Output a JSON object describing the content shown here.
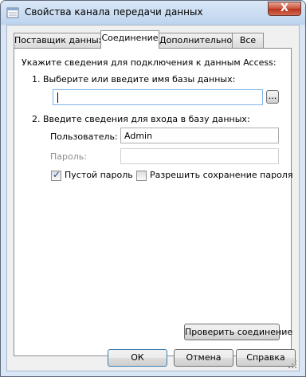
{
  "window": {
    "title": "Свойства канала передачи данных",
    "close_symbol": "X"
  },
  "tabs": [
    {
      "label": "Поставщик данных",
      "active": false
    },
    {
      "label": "Соединение",
      "active": true
    },
    {
      "label": "Дополнительно",
      "active": false
    },
    {
      "label": "Все",
      "active": false
    }
  ],
  "connection": {
    "intro": "Укажите сведения для подключения к данным Access:",
    "step1": "1. Выберите или введите имя базы данных:",
    "db_name_value": "",
    "browse_label": "...",
    "step2": "2. Введите сведения для входа в базу данных:",
    "user_label": "Пользователь:",
    "user_value": "Admin",
    "password_label": "Пароль:",
    "password_value": "",
    "blank_password_label": "Пустой пароль",
    "blank_password_checked": true,
    "save_password_label": "Разрешить сохранение пароля",
    "save_password_checked": false,
    "test_button": "Проверить соединение"
  },
  "footer": {
    "ok": "ОК",
    "cancel": "Отмена",
    "help": "Справка"
  }
}
